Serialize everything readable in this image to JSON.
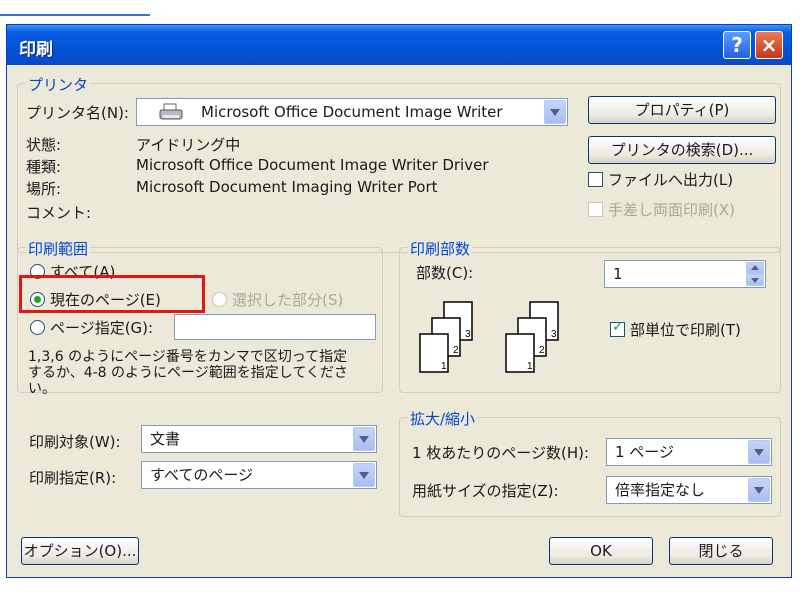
{
  "window": {
    "title": "印刷",
    "help_icon": "?",
    "close_icon": "×"
  },
  "printer": {
    "legend": "プリンタ",
    "name_label": "プリンタ名(N):",
    "name_value": "Microsoft Office Document Image Writer",
    "properties_button": "プロパティ(P)",
    "find_printer_button": "プリンタの検索(D)...",
    "status_label": "状態:",
    "status_value": "アイドリング中",
    "type_label": "種類:",
    "type_value": "Microsoft Office Document Image Writer Driver",
    "where_label": "場所:",
    "where_value": "Microsoft Document Imaging Writer Port",
    "comment_label": "コメント:",
    "print_to_file_label": "ファイルへ出力(L)",
    "print_to_file_checked": false,
    "manual_duplex_label": "手差し両面印刷(X)",
    "manual_duplex_checked": false
  },
  "page_range": {
    "legend": "印刷範囲",
    "all_label": "すべて(A)",
    "current_page_label": "現在のページ(E)",
    "selection_label": "選択した部分(S)",
    "pages_label": "ページ指定(G):",
    "pages_value": "",
    "selected": "current_page",
    "hint": [
      "1,3,6 のようにページ番号をカンマで区切って指定",
      "するか、4-8 のようにページ範囲を指定してくださ",
      "い。"
    ]
  },
  "copies": {
    "legend": "印刷部数",
    "count_label": "部数(C):",
    "count_value": "1",
    "collate_label": "部単位で印刷(T)",
    "collate_checked": true,
    "page_numbers": [
      "1",
      "2",
      "3"
    ]
  },
  "print_what": {
    "label": "印刷対象(W):",
    "value": "文書",
    "print_label": "印刷指定(R):",
    "print_value": "すべてのページ"
  },
  "zoom": {
    "legend": "拡大/縮小",
    "pages_per_sheet_label": "1 枚あたりのページ数(H):",
    "pages_per_sheet_value": "1 ページ",
    "scale_label": "用紙サイズの指定(Z):",
    "scale_value": "倍率指定なし"
  },
  "footer": {
    "options_button": "オプション(O)...",
    "ok_button": "OK",
    "close_button": "閉じる"
  },
  "colors": {
    "title_bar": "#0353d8",
    "group_legend": "#0046d5",
    "highlight_box": "#e31414",
    "dialog_bg": "#ece9d8"
  }
}
